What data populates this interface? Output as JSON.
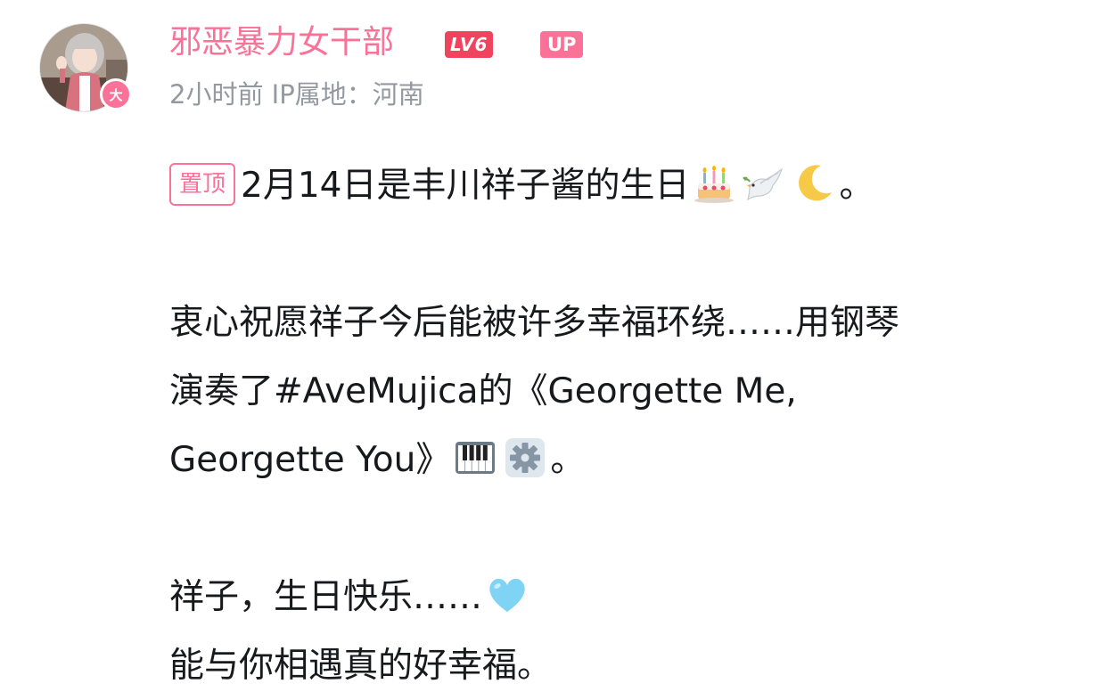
{
  "author": {
    "name": "邪恶暴力女干部",
    "level_badge": "LV6",
    "up_badge": "UP",
    "avatar_badge": "大",
    "meta": "2小时前 IP属地：河南"
  },
  "post": {
    "pin_tag": "置顶",
    "line1_text": "2月14日是丰川祥子酱的生日",
    "line1_end": "。",
    "line2_text": "衷心祝愿祥子今后能被许多幸福环绕……用钢琴",
    "line3_text": "演奏了#AveMujica的《Georgette Me,",
    "line4_text": "Georgette You》",
    "line4_end": "。",
    "line5_text": "祥子，生日快乐……",
    "line6_text": "能与你相遇真的好幸福。"
  },
  "emojis": {
    "line1": [
      "birthday-cake",
      "dove",
      "crescent-moon"
    ],
    "line4": [
      "piano-keys",
      "gear"
    ],
    "line5": [
      "light-blue-heart"
    ]
  },
  "colors": {
    "brand_pink": "#fb7299",
    "level_red": "#f0445e",
    "meta_gray": "#9499a0",
    "text": "#18191c"
  }
}
